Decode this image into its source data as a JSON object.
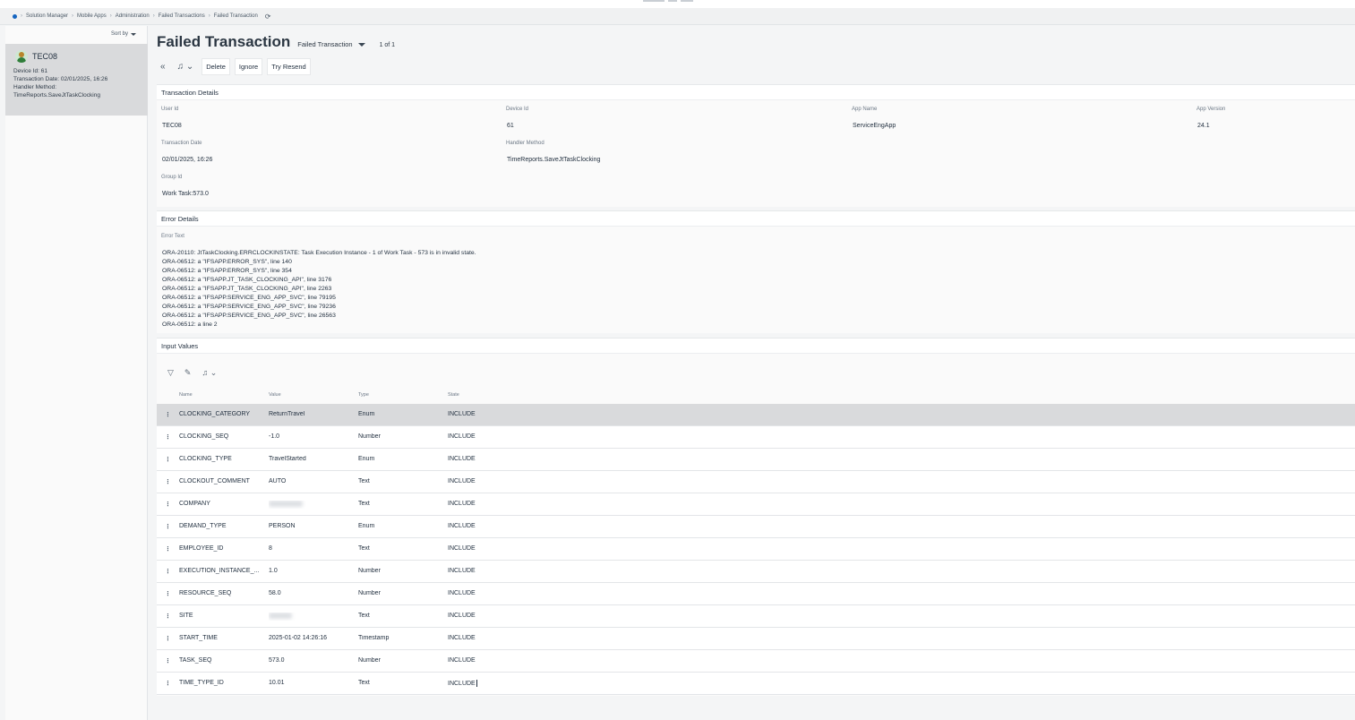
{
  "breadcrumb": {
    "items": [
      "Solution Manager",
      "Mobile Apps",
      "Administration",
      "Failed Transactions",
      "Failed Transaction"
    ]
  },
  "icons": {
    "home": "home-dot-icon",
    "refresh": "refresh-icon",
    "back": "double-chevron-left-icon",
    "notify": "bell-icon",
    "filter": "filter-icon",
    "edit": "pencil-icon",
    "row_menu": "kebab-icon"
  },
  "colors": {
    "accent": "#1565c0",
    "selected_row": "#d9dadc",
    "avatar_bg": "#cde8d2"
  },
  "sidebar": {
    "sort_label": "Sort by",
    "record": {
      "title": "TEC08",
      "device_line": "Device Id:  61",
      "date_line": "Transaction Date:  02/01/2025, 16:26",
      "handler_label": "Handler Method:",
      "handler_value": "TimeReports.SaveJtTaskClocking"
    }
  },
  "header": {
    "title": "Failed Transaction",
    "selector": "Failed Transaction",
    "count": "1 of 1"
  },
  "toolbar": {
    "delete": "Delete",
    "ignore": "Ignore",
    "resend": "Try Resend"
  },
  "transaction_details": {
    "title": "Transaction Details",
    "user_id_label": "User Id",
    "user_id": "TEC08",
    "device_id_label": "Device Id",
    "device_id": "61",
    "app_name_label": "App Name",
    "app_name": "ServiceEngApp",
    "app_version_label": "App Version",
    "app_version": "24.1",
    "transaction_date_label": "Transaction Date",
    "transaction_date": "02/01/2025, 16:26",
    "handler_method_label": "Handler Method",
    "handler_method": "TimeReports.SaveJtTaskClocking",
    "group_id_label": "Group Id",
    "group_id": "Work Task:573.0"
  },
  "error_details": {
    "title": "Error Details",
    "label": "Error Text",
    "lines": [
      "ORA-20110: JtTaskClocking.ERRCLOCKINSTATE: Task Execution Instance - 1 of Work Task - 573 is in invalid state.",
      "ORA-06512: a \"IFSAPP.ERROR_SYS\", line 140",
      "ORA-06512: a \"IFSAPP.ERROR_SYS\", line 354",
      "ORA-06512: a \"IFSAPP.JT_TASK_CLOCKING_API\", line 3176",
      "ORA-06512: a \"IFSAPP.JT_TASK_CLOCKING_API\", line 2263",
      "ORA-06512: a \"IFSAPP.SERVICE_ENG_APP_SVC\", line 79195",
      "ORA-06512: a \"IFSAPP.SERVICE_ENG_APP_SVC\", line 79236",
      "ORA-06512: a \"IFSAPP.SERVICE_ENG_APP_SVC\", line 26563",
      "ORA-06512: a line 2"
    ]
  },
  "input_values": {
    "title": "Input Values",
    "columns": {
      "name": "Name",
      "value": "Value",
      "type": "Type",
      "state": "State"
    },
    "rows": [
      {
        "name": "CLOCKING_CATEGORY",
        "value": "ReturnTravel",
        "type": "Enum",
        "state": "INCLUDE"
      },
      {
        "name": "CLOCKING_SEQ",
        "value": "-1.0",
        "type": "Number",
        "state": "INCLUDE"
      },
      {
        "name": "CLOCKING_TYPE",
        "value": "TravelStarted",
        "type": "Enum",
        "state": "INCLUDE"
      },
      {
        "name": "CLOCKOUT_COMMENT",
        "value": "AUTO",
        "type": "Text",
        "state": "INCLUDE"
      },
      {
        "name": "COMPANY",
        "value": "",
        "type": "Text",
        "state": "INCLUDE"
      },
      {
        "name": "DEMAND_TYPE",
        "value": "PERSON",
        "type": "Enum",
        "state": "INCLUDE"
      },
      {
        "name": "EMPLOYEE_ID",
        "value": "8",
        "type": "Text",
        "state": "INCLUDE"
      },
      {
        "name": "EXECUTION_INSTANCE_...",
        "value": "1.0",
        "type": "Number",
        "state": "INCLUDE"
      },
      {
        "name": "RESOURCE_SEQ",
        "value": "58.0",
        "type": "Number",
        "state": "INCLUDE"
      },
      {
        "name": "SITE",
        "value": "",
        "type": "Text",
        "state": "INCLUDE"
      },
      {
        "name": "START_TIME",
        "value": "2025-01-02 14:26:16",
        "type": "Timestamp",
        "state": "INCLUDE"
      },
      {
        "name": "TASK_SEQ",
        "value": "573.0",
        "type": "Number",
        "state": "INCLUDE"
      },
      {
        "name": "TIME_TYPE_ID",
        "value": "10.01",
        "type": "Text",
        "state": "INCLUDE"
      }
    ]
  }
}
